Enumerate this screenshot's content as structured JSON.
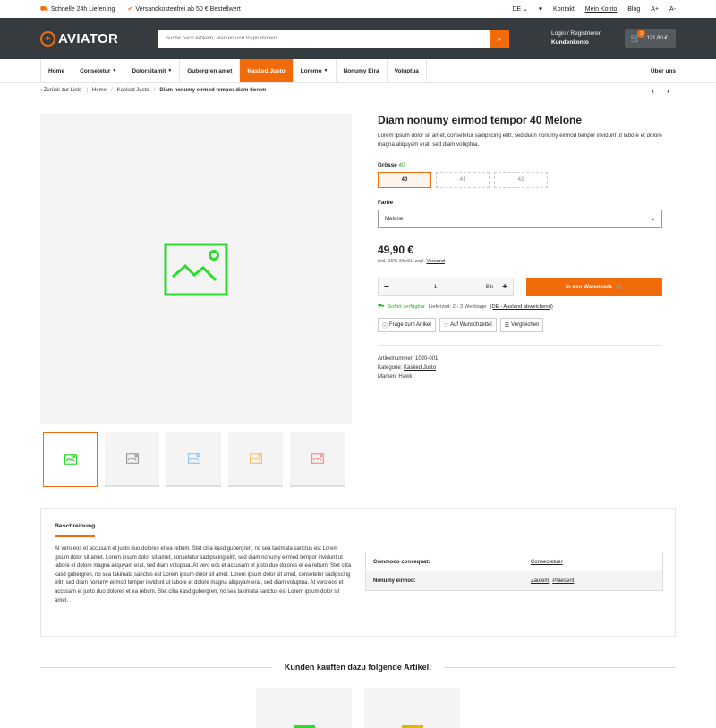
{
  "topbar": {
    "left": [
      {
        "icon": "truck-icon",
        "text": "Schnelle 24h Lieferung"
      },
      {
        "icon": "check-icon",
        "text": "Versandkostenfrei ab 50 € Bestellwert"
      }
    ],
    "lang": "DE",
    "contact": "Kontakt",
    "account": "Mein Konto",
    "blog": "Blog",
    "font_plus": "A+",
    "font_minus": "A-"
  },
  "header": {
    "logo": "AVIATOR",
    "search_placeholder": "Suche nach Artikeln, Marken und Inspirationen",
    "login": "Login / Registrieren",
    "customer": "Kundenkonto",
    "cart_count": "3",
    "cart_total": "121,80 €"
  },
  "nav": {
    "items": [
      {
        "label": "Home",
        "dropdown": false
      },
      {
        "label": "Consetetur",
        "dropdown": true
      },
      {
        "label": "Dolorsitamit",
        "dropdown": true
      },
      {
        "label": "Gubergren amet",
        "dropdown": false
      },
      {
        "label": "Kasked Justo",
        "dropdown": false,
        "active": true
      },
      {
        "label": "Loremo",
        "dropdown": true
      },
      {
        "label": "Nonumy Eira",
        "dropdown": false
      },
      {
        "label": "Voluptua",
        "dropdown": false
      }
    ],
    "about": "Über uns"
  },
  "breadcrumb": {
    "back": "Zurück zur Liste",
    "home": "Home",
    "category": "Kasked Justo",
    "current": "Diam nonumy eirmod tempor diam dorem"
  },
  "product": {
    "title": "Diam nonumy eirmod tempor 40 Melone",
    "description": "Lorem ipsum dolor sit amet, consetetur sadipscing elitr, sed diam nonumy eirmod tempor invidunt ut labore et dolore magna aliquyam erat, sed diam voluptua.",
    "size_label": "Grösse",
    "size_selected": "40",
    "sizes": [
      "40",
      "41",
      "42"
    ],
    "color_label": "Farbe",
    "color_value": "Melone",
    "price": "49,90 €",
    "tax_text": "inkl. 19% MwSt. zzgl.",
    "shipping_link": "Versand",
    "qty_minus": "−",
    "qty_value": "1",
    "qty_unit": "Stk",
    "qty_plus": "+",
    "add_to_cart": "In den Warenkorb",
    "stock_status": "Sofort verfügbar",
    "delivery": "Lieferzeit: 2 - 3 Werktage",
    "delivery_link": "(DE - Ausland abweichend)",
    "actions": [
      "Frage zum Artikel",
      "Auf Wunschzettel",
      "Vergleichen"
    ],
    "sku_label": "Artikelnummer:",
    "sku": "1020-001",
    "category_label": "Kategorie:",
    "category": "Kasked Justo",
    "brand_label": "Marken:",
    "brand": "Hawk"
  },
  "thumbnails": [
    {
      "color": "#2bdc2b"
    },
    {
      "color": "#9a9a9a"
    },
    {
      "color": "#8ec4f0"
    },
    {
      "color": "#f5c070"
    },
    {
      "color": "#f09090"
    }
  ],
  "colors": {
    "accent": "#f26b0a",
    "header_bg": "#363b40",
    "stock_green": "#2eaa2e",
    "placeholder_green": "#2bdc2b"
  },
  "description_tab": {
    "title": "Beschreibung",
    "text": "At vero eos et accusam et justo duo dolores et ea rebum. Stet clita kasd gubergren, no sea takimata sanctus est Lorem ipsum dolor sit amet. Lorem ipsum dolor sit amet, consetetur sadipscing elitr, sed diam nonumy eirmod tempor invidunt ut labore et dolore magna aliquyam erat, sed diam voluptua. At vero eos et accusam et justo duo dolores et ea rebum. Stet clita kasd gubergren, no sea takimata sanctus est Lorem ipsum dolor sit amet. Lorem ipsum dolor sit amet, consetetur sadipscing elitr, sed diam nonumy eirmod tempor invidunt ut labore et dolore magna aliquyam erat, sed diam voluptua. At vero eos et accusam et justo duo dolores et ea rebum. Stet clita kasd gubergren, no sea takimata sanctus est Lorem ipsum dolor sit amet.",
    "properties": [
      {
        "key": "Commodo consequat:",
        "values": [
          "Consectetuer"
        ]
      },
      {
        "key": "Nonumy eirmod:",
        "values": [
          "Zautem",
          "Praesent"
        ]
      }
    ]
  },
  "recommendations": {
    "title": "Kunden kauften dazu folgende Artikel:",
    "cards": [
      {
        "color": "#2bdc2b"
      },
      {
        "color": "#e0b800"
      }
    ]
  }
}
